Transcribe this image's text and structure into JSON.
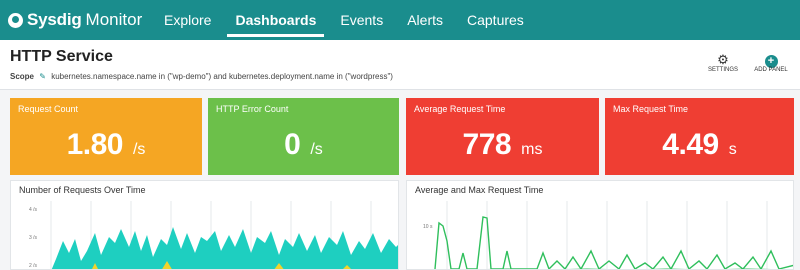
{
  "nav": {
    "brand": "Sysdig",
    "product": "Monitor",
    "tabs": [
      {
        "label": "Explore"
      },
      {
        "label": "Dashboards",
        "active": true
      },
      {
        "label": "Events"
      },
      {
        "label": "Alerts"
      },
      {
        "label": "Captures"
      }
    ]
  },
  "header": {
    "title": "HTTP Service",
    "scope_label": "Scope",
    "scope_text": "kubernetes.namespace.name in (\"wp-demo\") and kubernetes.deployment.name in (\"wordpress\")",
    "settings_label": "SETTINGS",
    "add_panel_label": "ADD PANEL"
  },
  "tiles": [
    {
      "title": "Request Count",
      "value": "1.80",
      "unit": "/s",
      "color": "#f5a623"
    },
    {
      "title": "HTTP Error Count",
      "value": "0",
      "unit": "/s",
      "color": "#6cc04a"
    },
    {
      "title": "Average Request Time",
      "value": "778",
      "unit": "ms",
      "color": "#ef3e33"
    },
    {
      "title": "Max Request Time",
      "value": "4.49",
      "unit": "s",
      "color": "#ef3e33"
    }
  ],
  "panels": {
    "requests": {
      "title": "Number of Requests Over Time",
      "ticks": [
        "4 /s",
        "3 /s",
        "2 /s"
      ]
    },
    "times": {
      "title": "Average and Max Request Time",
      "ticks": [
        "10 s"
      ]
    }
  },
  "colors": {
    "brand": "#1a8d8d",
    "area_teal": "#1ecfc0",
    "area_yellow": "#f2d32c",
    "line_green": "#2fbf5c"
  }
}
